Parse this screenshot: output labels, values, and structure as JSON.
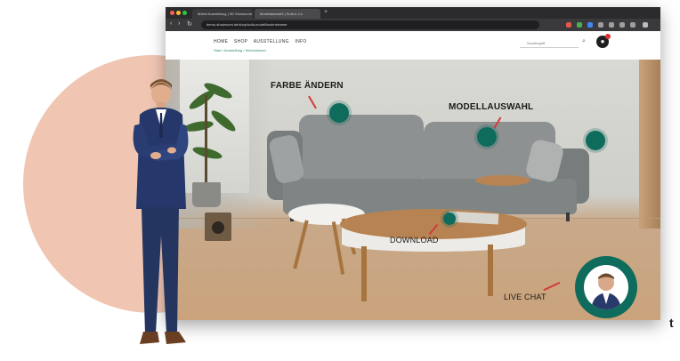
{
  "browser": {
    "tabs": [
      {
        "label": "Möbel Ausstellung | 3D Showroom"
      },
      {
        "label": "Modellauswahl | Sofa & Co"
      }
    ],
    "url": "demo-showroom.de/shop/sofa-modell/wohnzimmer"
  },
  "site": {
    "menu": [
      "HOME",
      "SHOP",
      "AUSSTELLUNG",
      "INFO"
    ],
    "breadcrumb": "Start / Ausstellung / Wohnzimmer",
    "search_placeholder": "Suchbegriff",
    "user_icon": "user-account-icon"
  },
  "hotspots": {
    "color_change_label": "FARBE ÄNDERN",
    "model_select_label": "MODELLAUSWAHL",
    "download_label": "DOWNLOAD",
    "live_chat_label": "LIVE CHAT"
  },
  "fragments": {
    "cut_letter": "t"
  },
  "colors": {
    "accent": "#0f6b5c",
    "circle": "#efc1ad",
    "badge": "#e03030"
  }
}
